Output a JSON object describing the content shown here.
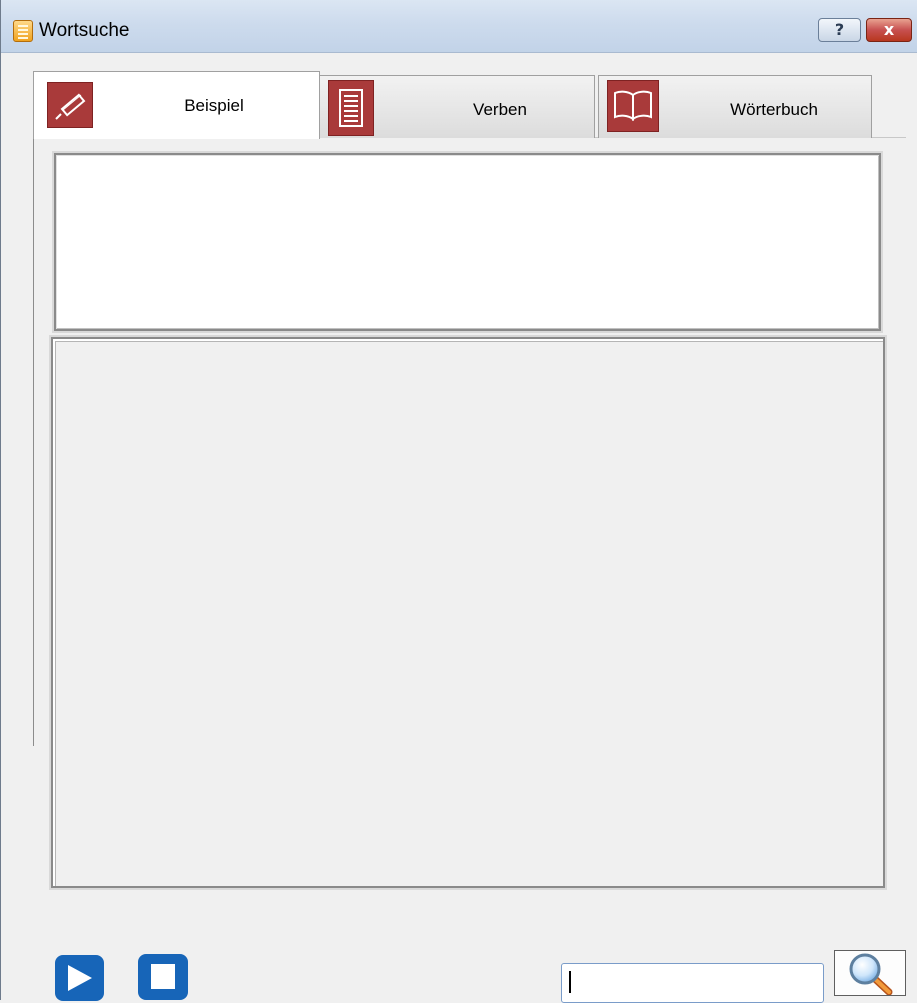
{
  "window": {
    "title": "Wortsuche",
    "icon": "document-icon",
    "help_button": "?",
    "close_button": "x"
  },
  "tabs": [
    {
      "label": "Beispiel",
      "icon": "pencil-icon",
      "active": true
    },
    {
      "label": "Verben",
      "icon": "document-lines-icon",
      "active": false
    },
    {
      "label": "Wörterbuch",
      "icon": "open-book-icon",
      "active": false
    }
  ],
  "content": {
    "text_box_value": "",
    "results_list_items": []
  },
  "controls": {
    "play_icon": "play-icon",
    "stop_icon": "stop-icon",
    "search_value": "",
    "search_icon": "magnifier-icon"
  },
  "colors": {
    "tab_icon_bg": "#a93a3a",
    "media_button": "#1765b8",
    "close_button": "#c75050"
  }
}
